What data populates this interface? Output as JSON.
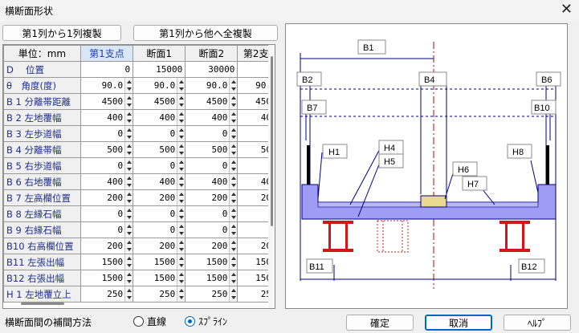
{
  "window": {
    "title": "横断面形状",
    "close_glyph": "✕"
  },
  "toolbar": {
    "copy_col1": "第1列から1列複製",
    "copy_all": "第1列から他へ全複製"
  },
  "grid": {
    "unit_header": "単位：mm",
    "columns": [
      "第1支点",
      "断面1",
      "断面2",
      "第2支"
    ],
    "rows": [
      {
        "label": "D　 位置",
        "values": [
          "0",
          "15000",
          "30000",
          ""
        ],
        "spin": [
          false,
          false,
          false,
          false
        ]
      },
      {
        "label": "θ　角度(度)",
        "values": [
          "90.0",
          "90.0",
          "90.0",
          "90."
        ],
        "spin": [
          true,
          true,
          true,
          false
        ]
      },
      {
        "label": "B 1 分離帯距離",
        "values": [
          "4500",
          "4500",
          "4500",
          "450"
        ],
        "spin": [
          true,
          true,
          true,
          false
        ]
      },
      {
        "label": "B 2 左地覆幅",
        "values": [
          "400",
          "400",
          "400",
          "40"
        ],
        "spin": [
          true,
          true,
          true,
          false
        ]
      },
      {
        "label": "B 3 左歩道幅",
        "values": [
          "0",
          "0",
          "0",
          ""
        ],
        "spin": [
          true,
          true,
          true,
          false
        ]
      },
      {
        "label": "B 4 分離帯幅",
        "values": [
          "500",
          "500",
          "500",
          "50"
        ],
        "spin": [
          true,
          true,
          true,
          false
        ]
      },
      {
        "label": "B 5 右歩道幅",
        "values": [
          "0",
          "0",
          "0",
          ""
        ],
        "spin": [
          true,
          true,
          true,
          false
        ]
      },
      {
        "label": "B 6 右地覆幅",
        "values": [
          "400",
          "400",
          "400",
          "40"
        ],
        "spin": [
          true,
          true,
          true,
          false
        ]
      },
      {
        "label": "B 7 左高欄位置",
        "values": [
          "200",
          "200",
          "200",
          "20"
        ],
        "spin": [
          true,
          true,
          true,
          false
        ]
      },
      {
        "label": "B 8 左縁石幅",
        "values": [
          "0",
          "0",
          "0",
          ""
        ],
        "spin": [
          true,
          true,
          true,
          false
        ]
      },
      {
        "label": "B 9 右縁石幅",
        "values": [
          "0",
          "0",
          "0",
          ""
        ],
        "spin": [
          true,
          true,
          true,
          false
        ]
      },
      {
        "label": "B10 右高欄位置",
        "values": [
          "200",
          "200",
          "200",
          "20"
        ],
        "spin": [
          true,
          true,
          true,
          false
        ]
      },
      {
        "label": "B11 左張出幅",
        "values": [
          "1500",
          "1500",
          "1500",
          "150"
        ],
        "spin": [
          true,
          true,
          true,
          false
        ]
      },
      {
        "label": "B12 右張出幅",
        "values": [
          "1500",
          "1500",
          "1500",
          "150"
        ],
        "spin": [
          true,
          true,
          true,
          false
        ]
      },
      {
        "label": "H 1 左地覆立上",
        "values": [
          "250",
          "250",
          "250",
          "25"
        ],
        "spin": [
          true,
          true,
          true,
          false
        ]
      }
    ]
  },
  "diagram": {
    "labels": {
      "b1": "B1",
      "b2": "B2",
      "b4": "B4",
      "b6": "B6",
      "b7": "B7",
      "b10": "B10",
      "h1": "H1",
      "h4": "H4",
      "h5": "H5",
      "h6": "H6",
      "h7": "H7",
      "h8": "H8",
      "b11": "B11",
      "b12": "B12"
    },
    "colors": {
      "deck": "#9f9cf5",
      "girder": "#d01818",
      "dim": "#000080",
      "center": "#c00000"
    }
  },
  "bottom": {
    "interp_label": "横断面間の補間方法",
    "radio_line": "直線",
    "radio_spline": "ｽﾌﾟﾗｲﾝ",
    "ok": "確定",
    "cancel": "取消",
    "help": "ﾍﾙﾌﾟ"
  }
}
